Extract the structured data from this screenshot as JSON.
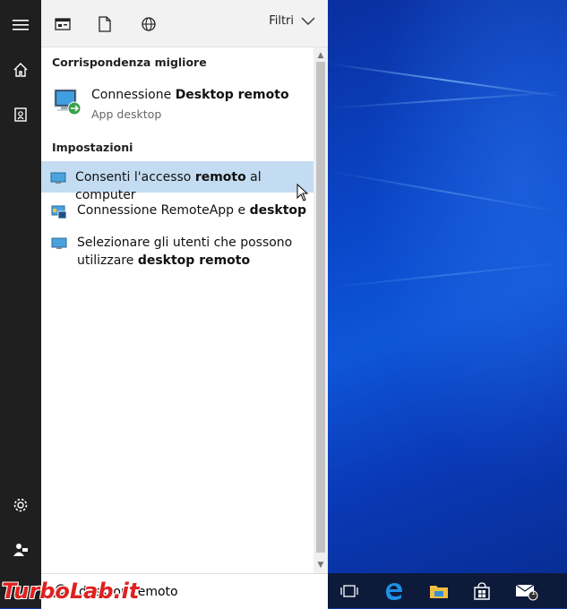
{
  "toolbar": {
    "filter_label": "Filtri",
    "icons": [
      "apps-icon",
      "document-icon",
      "web-icon"
    ]
  },
  "rail": {
    "icons": [
      "hamburger-icon",
      "home-icon",
      "notebook-icon",
      "settings-icon",
      "feedback-icon"
    ]
  },
  "best_match": {
    "header": "Corrispondenza migliore",
    "title_plain": "Connessione ",
    "title_bold": "Desktop remoto",
    "subtitle": "App desktop"
  },
  "settings": {
    "header": "Impostazioni",
    "items": [
      {
        "pre": "Consenti l'accesso ",
        "bold": "remoto",
        "post": " al computer",
        "selected": true
      },
      {
        "pre": "Connessione RemoteApp e ",
        "bold": "desktop",
        "post": "",
        "selected": false
      },
      {
        "pre": "Selezionare gli utenti che possono utilizzare ",
        "bold": "desktop remoto",
        "post": "",
        "selected": false
      }
    ]
  },
  "search": {
    "query": "desktop remoto"
  },
  "taskbar": {
    "icons": [
      "task-view-icon",
      "edge-icon",
      "file-explorer-icon",
      "store-icon",
      "mail-icon"
    ],
    "mail_badge": "1"
  },
  "watermark": "TurboLab.it",
  "colors": {
    "selection": "#c4dcf2",
    "rail": "#1f1f1f",
    "accent": "#0078d7"
  }
}
